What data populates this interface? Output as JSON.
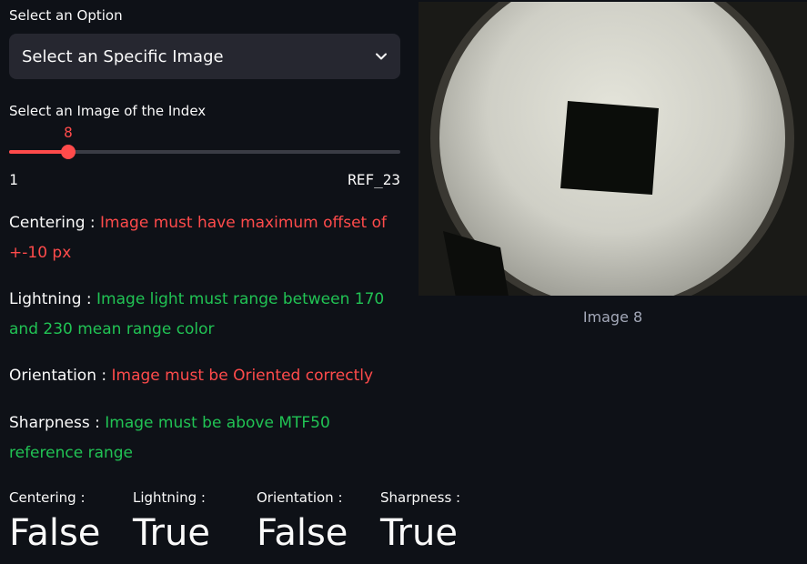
{
  "select": {
    "label": "Select an Option",
    "value": "Select an Specific Image"
  },
  "slider": {
    "label": "Select an Image of the Index",
    "value": "8",
    "min_label": "1",
    "max_label": "REF_23",
    "value_fraction": 0.15
  },
  "checks": {
    "centering": {
      "label": "Centering : ",
      "message": "Image must have maximum offset of +-10 px"
    },
    "lightning": {
      "label": "Lightning : ",
      "message": "Image light must range between 170 and 230 mean range color"
    },
    "orientation": {
      "label": "Orientation : ",
      "message": "Image must be Oriented correctly"
    },
    "sharpness": {
      "label": "Sharpness : ",
      "message": "Image must be above MTF50 reference range"
    }
  },
  "metrics": [
    {
      "label": "Centering :",
      "value": "False"
    },
    {
      "label": "Lightning :",
      "value": "True"
    },
    {
      "label": "Orientation :",
      "value": "False"
    },
    {
      "label": "Sharpness :",
      "value": "True"
    }
  ],
  "image": {
    "caption": "Image 8"
  },
  "colors": {
    "background": "#0e1117",
    "accent_red": "#ff4b4b",
    "accent_green": "#21c354",
    "widget_bg": "#262730"
  }
}
